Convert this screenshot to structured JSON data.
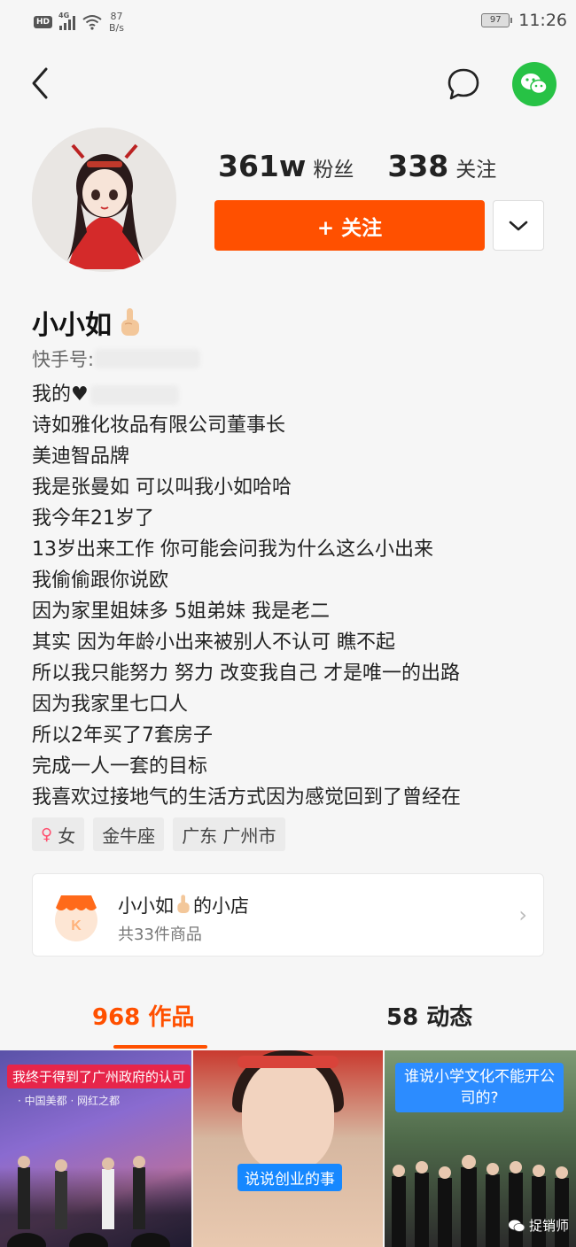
{
  "status_bar": {
    "hd": "HD",
    "network": "4G",
    "speed_value": "87",
    "speed_unit": "B/s",
    "battery": "97",
    "time": "11:26"
  },
  "topbar": {
    "back_icon": "back-arrow-icon",
    "message_icon": "chat-bubble-icon",
    "share_icon": "wechat-icon",
    "share_color": "#27c245"
  },
  "profile": {
    "followers_count": "361w",
    "followers_label": "粉丝",
    "following_count": "338",
    "following_label": "关注",
    "follow_button": "+ 关注",
    "follow_color": "#ff5000",
    "name": "小小如",
    "id_label": "快手号: "
  },
  "bio": [
    "我的♥",
    "诗如雅化妆品有限公司董事长",
    "美迪智品牌",
    "我是张曼如 可以叫我小如哈哈",
    "我今年21岁了",
    "13岁出来工作 你可能会问我为什么这么小出来",
    "我偷偷跟你说欧",
    "因为家里姐妹多 5姐弟妹 我是老二",
    "其实 因为年龄小出来被别人不认可 瞧不起",
    "所以我只能努力 努力 改变我自己 才是唯一的出路",
    "因为我家里七口人",
    "所以2年买了7套房子",
    "完成一人一套的目标",
    "我喜欢过接地气的生活方式因为感觉回到了曾经在"
  ],
  "tags": {
    "gender": "女",
    "zodiac": "金牛座",
    "location": "广东 广州市"
  },
  "shop": {
    "title_name": "小小如",
    "title_suffix": "的小店",
    "subtitle": "共33件商品",
    "logo_letter": "K"
  },
  "tabs": {
    "works": "968 作品",
    "moments": "58 动态"
  },
  "videos": {
    "v1_caption": "我终于得到了广州政府的认可",
    "v1_sub": "· 中国美都 · 网红之都",
    "v2_caption": "说说创业的事",
    "v3_caption": "谁说小学文化不能开公司的?",
    "watermark": "捉销师"
  }
}
